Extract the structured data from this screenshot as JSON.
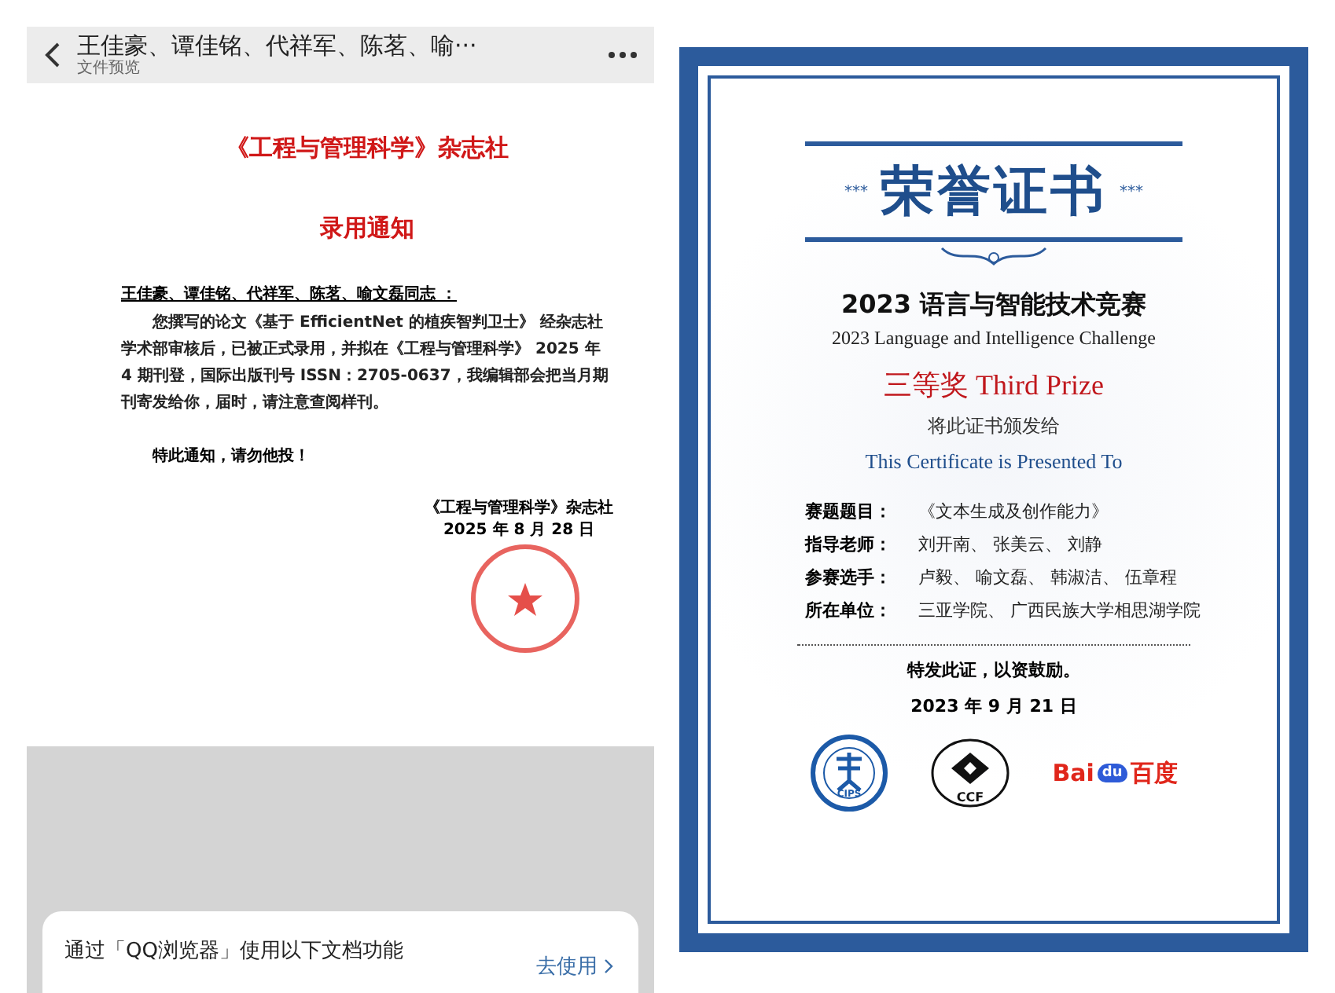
{
  "phone_preview": {
    "title": "王佳豪、谭佳铭、代祥军、陈茗、喻···",
    "subtitle": "文件预览",
    "document": {
      "publisher": "《工程与管理科学》杂志社",
      "heading": "录用通知",
      "salutation": "王佳豪、谭佳铭、代祥军、陈茗、喻文磊同志 ：",
      "body": "您撰写的论文《基于 EfficientNet 的植疾智判卫士》 经杂志社学术部审核后，已被正式录用，并拟在《工程与管理科学》 2025 年 4 期刊登，国际出版刊号 ISSN：2705-0637，我编辑部会把当月期刊寄发给你，届时，请注意查阅样刊。",
      "closing": "特此通知，请勿他投！",
      "signature": "《工程与管理科学》杂志社",
      "date": "2025 年 8 月 28 日"
    },
    "banner": {
      "text": "通过「QQ浏览器」使用以下文档功能",
      "action": "去使用"
    }
  },
  "certificate": {
    "title": "荣誉证书",
    "stars_left": "***",
    "stars_right": "***",
    "contest": "2023 语言与智能技术竞赛",
    "contest_en": "2023 Language and Intelligence Challenge",
    "prize": "三等奖 Third Prize",
    "presented_cn": "将此证书颁发给",
    "presented_en": "This Certificate is Presented To",
    "fields": [
      {
        "label": "赛题题目：",
        "value": "《文本生成及创作能力》"
      },
      {
        "label": "指导老师：",
        "value": "刘开南、 张美云、 刘静"
      },
      {
        "label": "参赛选手：",
        "value": "卢毅、 喻文磊、 韩淑洁、 伍章程"
      },
      {
        "label": "所在单位：",
        "value": "三亚学院、 广西民族大学相思湖学院"
      }
    ],
    "closing": "特发此证，以资鼓励。",
    "date": "2023 年 9 月 21 日",
    "logos": [
      {
        "kind": "seal",
        "text": "CIPS"
      },
      {
        "kind": "ring",
        "text": "CCF"
      },
      {
        "kind": "wordmark",
        "text": "Bai",
        "badge": "du",
        "suffix": "百度"
      }
    ]
  }
}
